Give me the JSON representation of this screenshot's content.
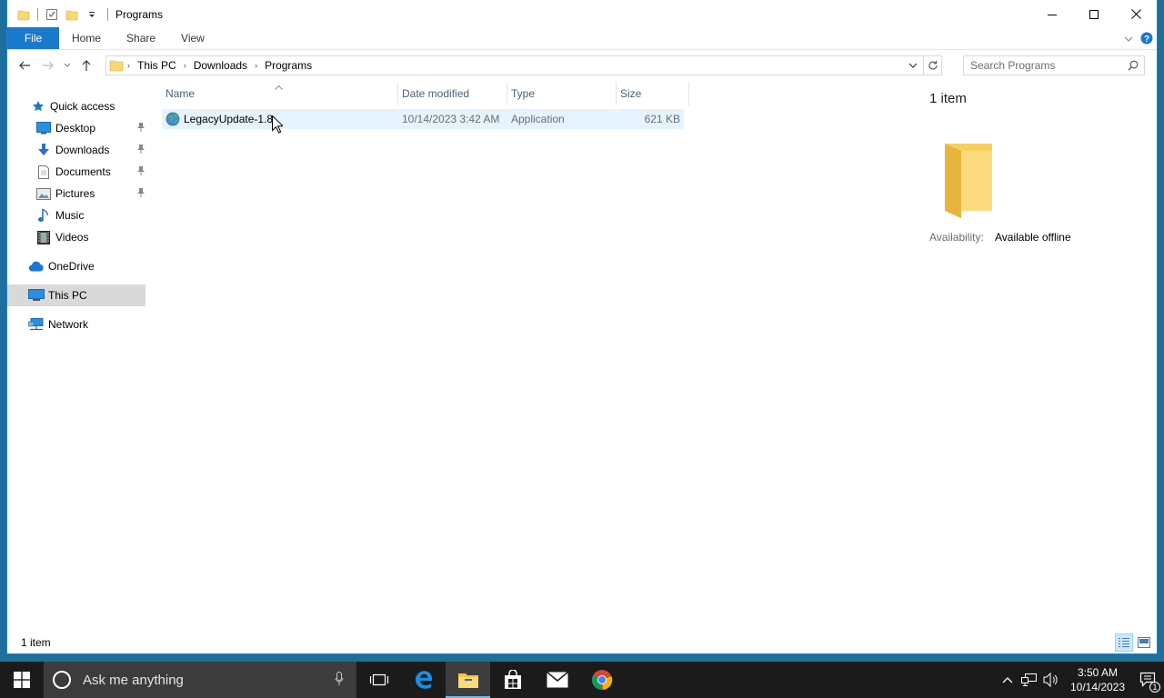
{
  "window": {
    "title": "Programs"
  },
  "ribbon": {
    "tabs": [
      {
        "label": "File"
      },
      {
        "label": "Home"
      },
      {
        "label": "Share"
      },
      {
        "label": "View"
      }
    ]
  },
  "address": {
    "breadcrumbs": [
      "This PC",
      "Downloads",
      "Programs"
    ],
    "search_placeholder": "Search Programs"
  },
  "nav": {
    "quick_access": "Quick access",
    "items": [
      {
        "label": "Desktop",
        "pinned": true
      },
      {
        "label": "Downloads",
        "pinned": true
      },
      {
        "label": "Documents",
        "pinned": true
      },
      {
        "label": "Pictures",
        "pinned": true
      },
      {
        "label": "Music",
        "pinned": false
      },
      {
        "label": "Videos",
        "pinned": false
      }
    ],
    "onedrive": "OneDrive",
    "this_pc": "This PC",
    "network": "Network"
  },
  "columns": {
    "name": "Name",
    "date": "Date modified",
    "type": "Type",
    "size": "Size"
  },
  "files": [
    {
      "name": "LegacyUpdate-1.8",
      "date": "10/14/2023 3:42 AM",
      "type": "Application",
      "size": "621 KB"
    }
  ],
  "details": {
    "count": "1 item",
    "availability_label": "Availability:",
    "availability_value": "Available offline"
  },
  "status": {
    "text": "1 item"
  },
  "taskbar": {
    "search_placeholder": "Ask me anything",
    "time": "3:50 AM",
    "date": "10/14/2023",
    "notification_count": "1"
  },
  "colors": {
    "accent": "#1979ca",
    "selection": "#e5f3ff",
    "taskbar": "#1b1b1b",
    "folder": "#f4c85a"
  }
}
